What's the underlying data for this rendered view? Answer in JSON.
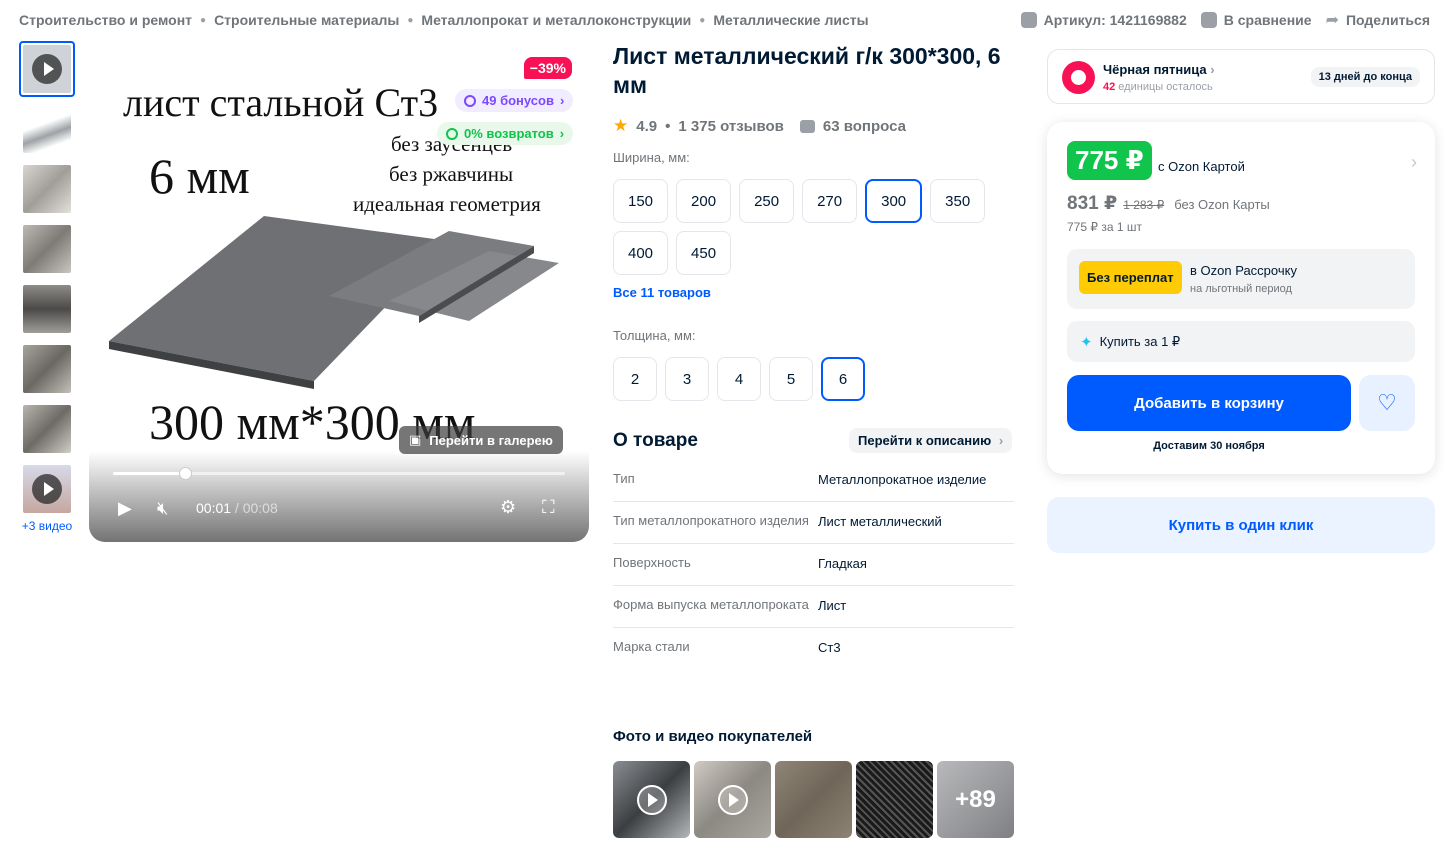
{
  "breadcrumbs": [
    "Строительство и ремонт",
    "Строительные материалы",
    "Металлопрокат и металлоконструкции",
    "Металлические листы"
  ],
  "top_actions": {
    "article": "Артикул: 1421169882",
    "compare": "В сравнение",
    "share": "Поделиться"
  },
  "gallery": {
    "more_videos": "+3 видео",
    "discount": "−39%",
    "bonus": "49 бонусов",
    "returns": "0% возвратов",
    "go_gallery": "Перейти в галерею",
    "image_text": {
      "line1": "лист стальной Ст3",
      "line2": "6 мм",
      "line3": "без заусенцев",
      "line4": "без ржавчины",
      "line5": "идеальная геометрия",
      "line6": "300 мм*300 мм"
    },
    "video": {
      "current": "00:01",
      "total": "00:08",
      "progress": 0.16
    }
  },
  "product": {
    "title": "Лист металлический г/к 300*300, 6 мм",
    "rating": "4.9",
    "reviews": "1 375 отзывов",
    "questions": "63 вопроса"
  },
  "width_option": {
    "label": "Ширина, мм:",
    "values": [
      "150",
      "200",
      "250",
      "270",
      "300",
      "350",
      "400",
      "450"
    ],
    "selected": "300",
    "all_link": "Все 11 товаров"
  },
  "thickness_option": {
    "label": "Толщина, мм:",
    "values": [
      "2",
      "3",
      "4",
      "5",
      "6"
    ],
    "selected": "6"
  },
  "about": {
    "title": "О товаре",
    "goto": "Перейти к описанию",
    "specs": [
      {
        "k": "Тип",
        "v": "Металлопрокатное изделие"
      },
      {
        "k": "Тип металлопрокатного изделия",
        "v": "Лист металлический"
      },
      {
        "k": "Поверхность",
        "v": "Гладкая"
      },
      {
        "k": "Форма выпуска металлопроката",
        "v": "Лист"
      },
      {
        "k": "Марка стали",
        "v": "Ст3"
      }
    ]
  },
  "ugc": {
    "title": "Фото и видео покупателей",
    "more": "+89"
  },
  "promo": {
    "title": "Чёрная пятница",
    "count": "42",
    "count_suffix": " единицы осталось",
    "days": "13 дней до конца"
  },
  "price": {
    "card_price": "775 ₽",
    "card_note": "с Ozon Картой",
    "regular": "831 ₽",
    "old": "1 283 ₽",
    "regular_note": "без Ozon Карты",
    "per_unit": "775 ₽ за 1 шт",
    "installment_badge": "Без переплат",
    "installment_title": "в Ozon Рассрочку",
    "installment_sub": "на льготный период",
    "buy_for": "Купить за 1 ₽",
    "add_to_cart": "Добавить в корзину",
    "delivery": "Доставим 30 ноября",
    "one_click": "Купить в один клик"
  },
  "colors": {
    "accent": "#005bff",
    "price_green": "#10c44c",
    "discount_red": "#f91155",
    "installment_yellow": "#ffcb05"
  }
}
